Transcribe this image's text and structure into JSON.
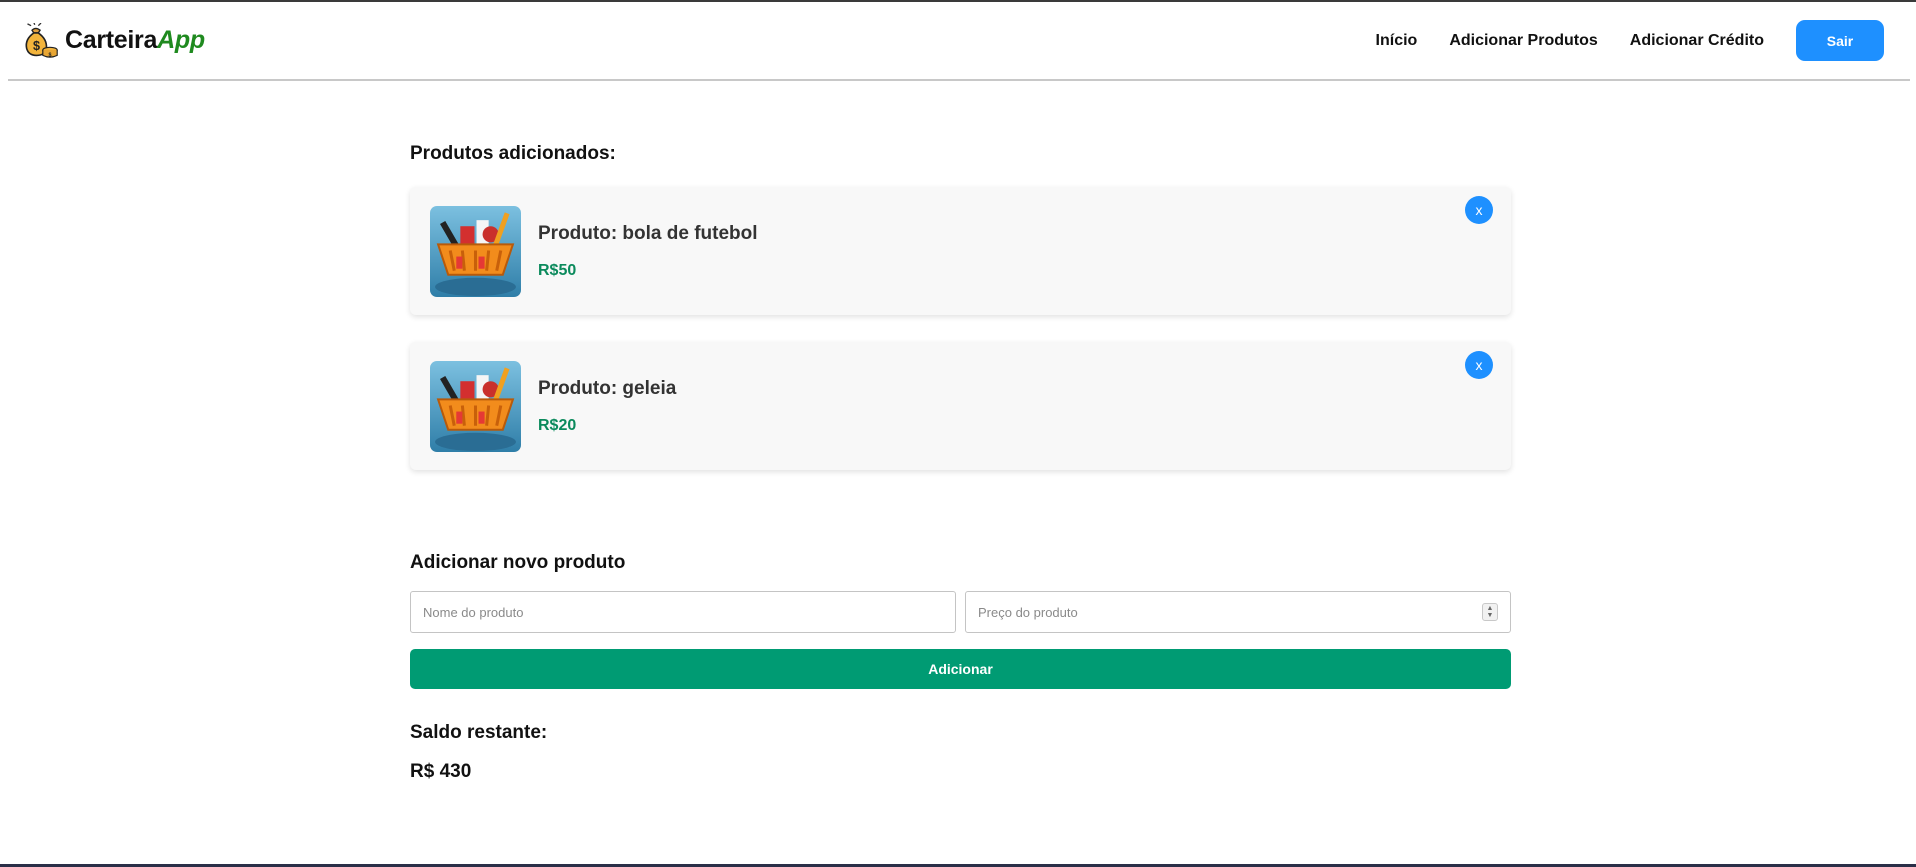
{
  "brand": {
    "name": "Carteira",
    "accent": "App",
    "logo_icon": "money-bag-icon",
    "accent_color": "#1f8a1f"
  },
  "nav": {
    "links": [
      "Início",
      "Adicionar Produtos",
      "Adicionar Crédito"
    ],
    "logout_label": "Sair",
    "button_color": "#1e90ff"
  },
  "products": {
    "title": "Produtos adicionados:",
    "items": [
      {
        "name": "Produto: bola de futebol",
        "price": "R$50",
        "image_icon": "shopping-basket-icon",
        "remove_label": "x"
      },
      {
        "name": "Produto: geleia",
        "price": "R$20",
        "image_icon": "shopping-basket-icon",
        "remove_label": "x"
      }
    ]
  },
  "form": {
    "title": "Adicionar novo produto",
    "name_placeholder": "Nome do produto",
    "price_placeholder": "Preço do produto",
    "submit_label": "Adicionar",
    "submit_color": "#009b73"
  },
  "balance": {
    "label": "Saldo restante:",
    "value": "R$ 430"
  }
}
